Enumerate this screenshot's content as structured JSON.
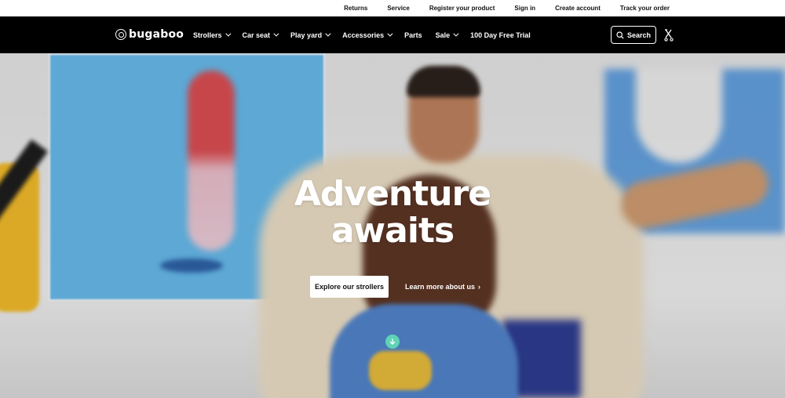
{
  "utility_nav": {
    "returns": "Returns",
    "service": "Service",
    "register_product": "Register your product",
    "sign_in": "Sign in",
    "create_account": "Create account",
    "track_order": "Track your order"
  },
  "brand": {
    "logo_text": "bugaboo"
  },
  "main_nav": {
    "items": [
      {
        "label": "Strollers",
        "has_dropdown": true
      },
      {
        "label": "Car seat",
        "has_dropdown": true
      },
      {
        "label": "Play yard",
        "has_dropdown": true
      },
      {
        "label": "Accessories",
        "has_dropdown": true
      },
      {
        "label": "Parts",
        "has_dropdown": false
      },
      {
        "label": "Sale",
        "has_dropdown": true
      },
      {
        "label": "100 Day Free Trial",
        "has_dropdown": false
      }
    ],
    "search_label": "Search"
  },
  "hero": {
    "title_line1": "Adventure",
    "title_line2": "awaits",
    "primary_cta": "Explore our strollers",
    "secondary_cta": "Learn more about us",
    "secondary_arrow": "›"
  },
  "colors": {
    "nav_bg": "#000000",
    "scroll_badge": "#5fd3b6"
  },
  "icons": {
    "logo": "bugaboo-logo-icon",
    "search": "search-icon",
    "cart": "stroller-cart-icon",
    "scroll": "arrow-down-icon"
  }
}
